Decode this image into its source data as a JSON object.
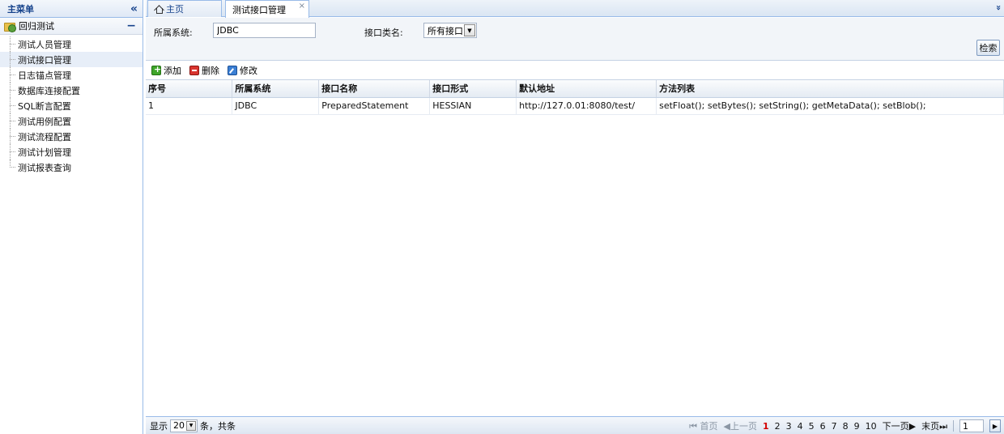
{
  "sidebar": {
    "title": "主菜单",
    "collapse_icon": "«",
    "root": {
      "label": "回归测试",
      "toggle": "−"
    },
    "items": [
      {
        "label": "测试人员管理"
      },
      {
        "label": "测试接口管理"
      },
      {
        "label": "日志锚点管理"
      },
      {
        "label": "数据库连接配置"
      },
      {
        "label": "SQL断言配置"
      },
      {
        "label": "测试用例配置"
      },
      {
        "label": "测试流程配置"
      },
      {
        "label": "测试计划管理"
      },
      {
        "label": "测试报表查询"
      }
    ],
    "selected_index": 1
  },
  "tabs": {
    "home": "主页",
    "active": "测试接口管理",
    "close": "×",
    "scroll_icon": "»"
  },
  "search": {
    "system_label": "所属系统:",
    "system_value": "JDBC",
    "type_label": "接口类名:",
    "type_value": "所有接口",
    "button": "检索"
  },
  "toolbar": {
    "add": "添加",
    "delete": "删除",
    "edit": "修改"
  },
  "table": {
    "columns": [
      "序号",
      "所属系统",
      "接口名称",
      "接口形式",
      "默认地址",
      "方法列表"
    ],
    "rows": [
      [
        "1",
        "JDBC",
        "PreparedStatement",
        "HESSIAN",
        "http://127.0.01:8080/test/",
        "setFloat();  setBytes();  setString();  getMetaData();  setBlob();"
      ]
    ]
  },
  "footer": {
    "show_label": "显示",
    "page_size": "20",
    "total_label": "条，共条",
    "first": "首页",
    "prev": "上一页",
    "pages": [
      "1",
      "2",
      "3",
      "4",
      "5",
      "6",
      "7",
      "8",
      "9",
      "10"
    ],
    "current_page": "1",
    "next": "下一页",
    "last": "末页",
    "page_input": "1"
  },
  "colors": {
    "border": "#99bbe8",
    "header_text": "#15428b",
    "current_page": "#d40000"
  }
}
